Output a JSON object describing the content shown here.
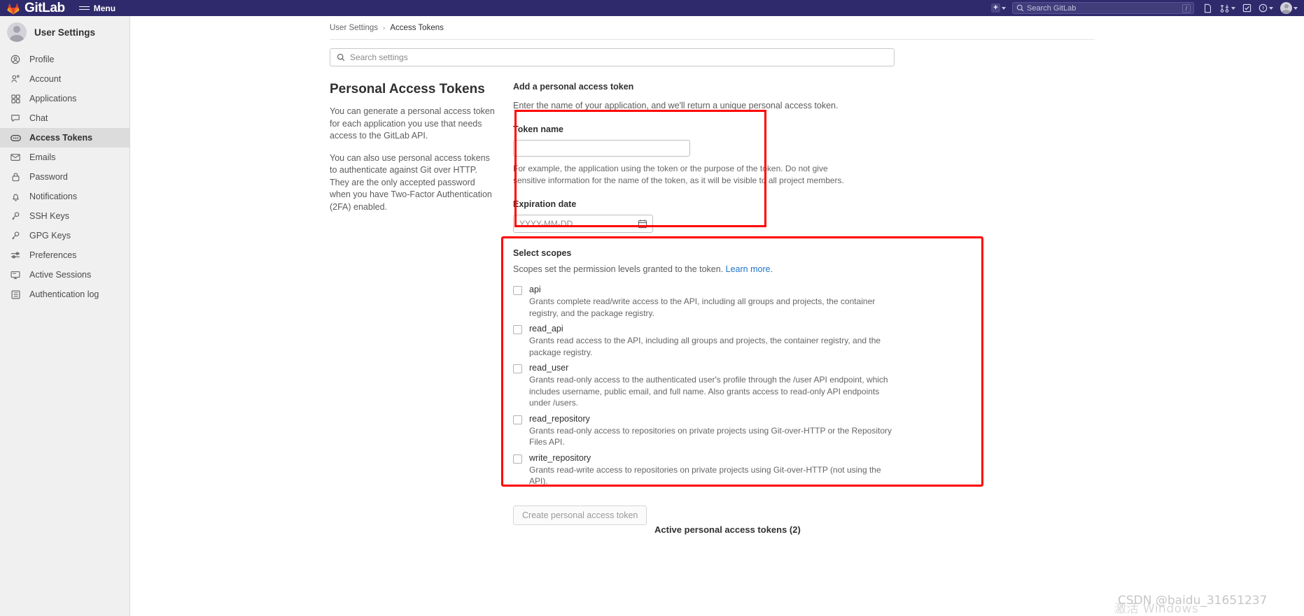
{
  "navbar": {
    "brand": "GitLab",
    "menu_label": "Menu",
    "new_button": "+",
    "search_placeholder": "Search GitLab",
    "search_shortcut": "/",
    "icons": [
      "new-plus-icon",
      "issues-icon",
      "merge-requests-icon",
      "todos-icon",
      "help-icon",
      "user-avatar-icon"
    ]
  },
  "sidebar": {
    "title": "User Settings",
    "items": [
      {
        "label": "Profile",
        "icon": "user-circle-icon",
        "active": false
      },
      {
        "label": "Account",
        "icon": "account-key-icon",
        "active": false
      },
      {
        "label": "Applications",
        "icon": "applications-grid-icon",
        "active": false
      },
      {
        "label": "Chat",
        "icon": "chat-bubble-icon",
        "active": false
      },
      {
        "label": "Access Tokens",
        "icon": "token-icon",
        "active": true
      },
      {
        "label": "Emails",
        "icon": "envelope-icon",
        "active": false
      },
      {
        "label": "Password",
        "icon": "lock-icon",
        "active": false
      },
      {
        "label": "Notifications",
        "icon": "bell-icon",
        "active": false
      },
      {
        "label": "SSH Keys",
        "icon": "key-icon",
        "active": false
      },
      {
        "label": "GPG Keys",
        "icon": "key-icon",
        "active": false
      },
      {
        "label": "Preferences",
        "icon": "sliders-icon",
        "active": false
      },
      {
        "label": "Active Sessions",
        "icon": "monitor-icon",
        "active": false
      },
      {
        "label": "Authentication log",
        "icon": "log-list-icon",
        "active": false
      }
    ]
  },
  "breadcrumb": {
    "parent": "User Settings",
    "separator": "›",
    "current": "Access Tokens"
  },
  "search_settings": {
    "placeholder": "Search settings",
    "value": "",
    "icon": "search-icon"
  },
  "overview": {
    "title": "Personal Access Tokens",
    "paragraph1": "You can generate a personal access token for each application you use that needs access to the GitLab API.",
    "paragraph2": "You can also use personal access tokens to authenticate against Git over HTTP. They are the only accepted password when you have Two-Factor Authentication (2FA) enabled."
  },
  "form": {
    "title": "Add a personal access token",
    "subtitle": "Enter the name of your application, and we'll return a unique personal access token.",
    "token_name_label": "Token name",
    "token_name_value": "",
    "token_name_placeholder": "",
    "token_name_help": "For example, the application using the token or the purpose of the token. Do not give sensitive information for the name of the token, as it will be visible to all project members.",
    "expiration_label": "Expiration date",
    "expiration_placeholder": "YYYY-MM-DD",
    "expiration_value": "",
    "calendar_icon": "calendar-icon",
    "submit_label": "Create personal access token",
    "submit_disabled": true
  },
  "scopes": {
    "title": "Select scopes",
    "description": "Scopes set the permission levels granted to the token.",
    "learn_more": "Learn more.",
    "items": [
      {
        "name": "api",
        "checked": false,
        "description": "Grants complete read/write access to the API, including all groups and projects, the container registry, and the package registry."
      },
      {
        "name": "read_api",
        "checked": false,
        "description": "Grants read access to the API, including all groups and projects, the container registry, and the package registry."
      },
      {
        "name": "read_user",
        "checked": false,
        "description": "Grants read-only access to the authenticated user's profile through the /user API endpoint, which includes username, public email, and full name. Also grants access to read-only API endpoints under /users."
      },
      {
        "name": "read_repository",
        "checked": false,
        "description": "Grants read-only access to repositories on private projects using Git-over-HTTP or the Repository Files API."
      },
      {
        "name": "write_repository",
        "checked": false,
        "description": "Grants read-write access to repositories on private projects using Git-over-HTTP (not using the API)."
      }
    ]
  },
  "active_tokens": {
    "heading": "Active personal access tokens (2)"
  },
  "annotations": {
    "color": "#ff0000",
    "boxes": [
      "token-name-and-expiration-highlight",
      "select-scopes-highlight"
    ]
  },
  "watermarks": {
    "windows": "激活 Windows",
    "csdn": "CSDN @baidu_31651237"
  }
}
